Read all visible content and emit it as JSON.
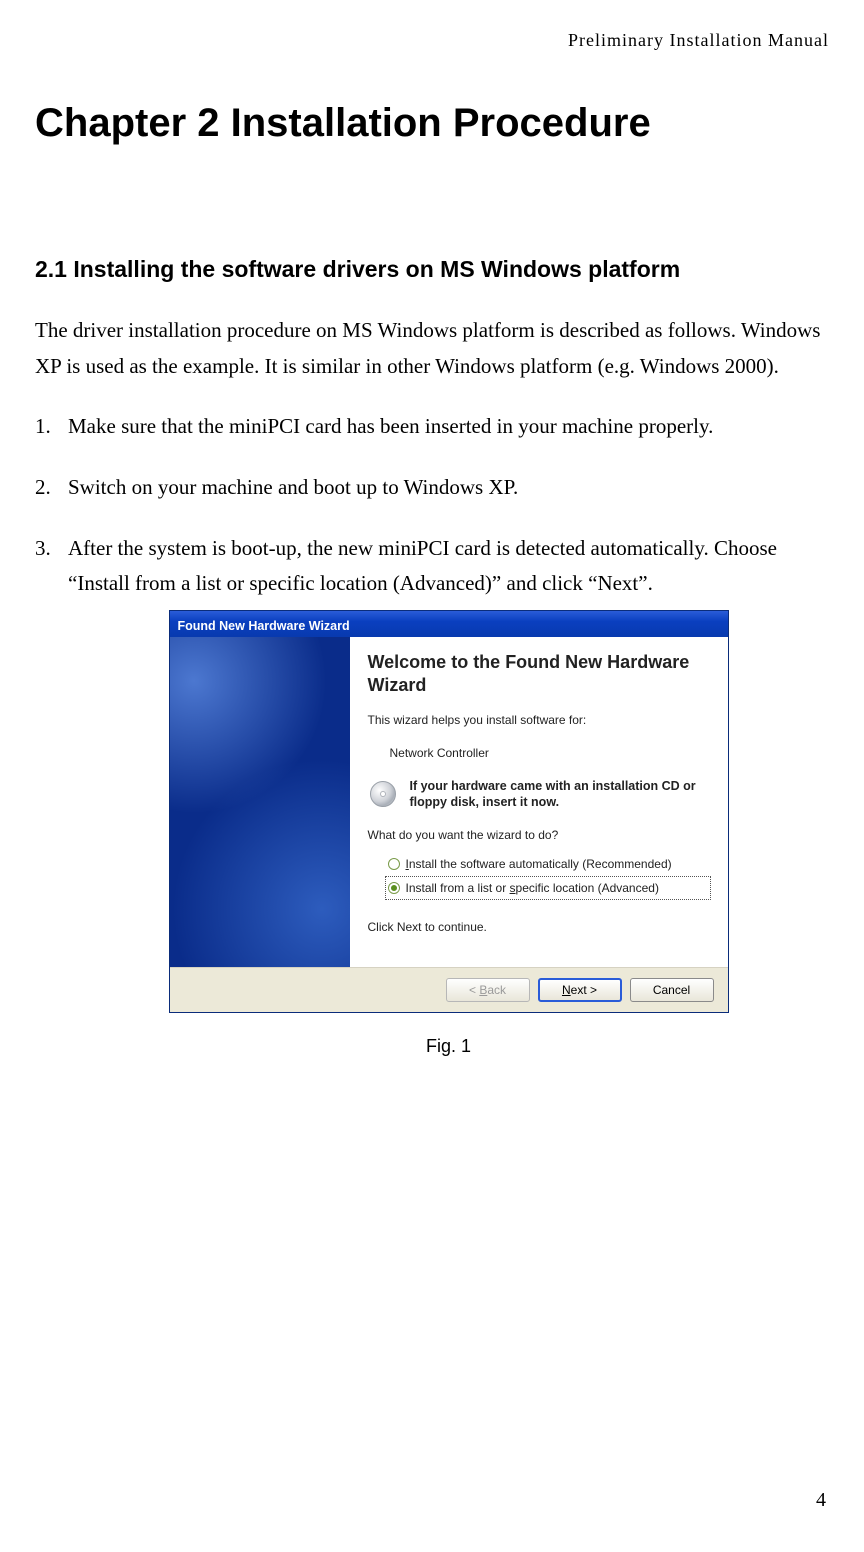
{
  "header": {
    "running": "Preliminary  Installation  Manual"
  },
  "chapter": {
    "title": "Chapter 2 Installation Procedure"
  },
  "section": {
    "title": "2.1 Installing the software drivers on MS Windows platform"
  },
  "intro": "The driver installation procedure on MS Windows platform is described as follows. Windows XP is used as the example. It is similar in other Windows platform (e.g. Windows 2000).",
  "steps": [
    "Make sure that the miniPCI card has been inserted in your machine properly.",
    "Switch on your machine and boot up to Windows XP.",
    "After the system is boot-up, the new miniPCI card is detected automatically. Choose “Install from a list or specific location (Advanced)” and click “Next”."
  ],
  "wizard": {
    "titlebar": "Found New Hardware Wizard",
    "welcome": "Welcome to the Found New Hardware Wizard",
    "helps": "This wizard helps you install software for:",
    "device": "Network Controller",
    "cd_note": "If your hardware came with an installation CD or floppy disk, insert it now.",
    "prompt": "What do you want the wizard to do?",
    "opt_auto_pre": "",
    "opt_auto_u": "I",
    "opt_auto_post": "nstall the software automatically (Recommended)",
    "opt_list_pre": "Install from a list or ",
    "opt_list_u": "s",
    "opt_list_post": "pecific location (Advanced)",
    "continue": "Click Next to continue.",
    "buttons": {
      "back_pre": "< ",
      "back_u": "B",
      "back_post": "ack",
      "next_u": "N",
      "next_post": "ext >",
      "cancel": "Cancel"
    }
  },
  "figure": {
    "caption": "Fig. 1"
  },
  "page": {
    "number": "4"
  }
}
